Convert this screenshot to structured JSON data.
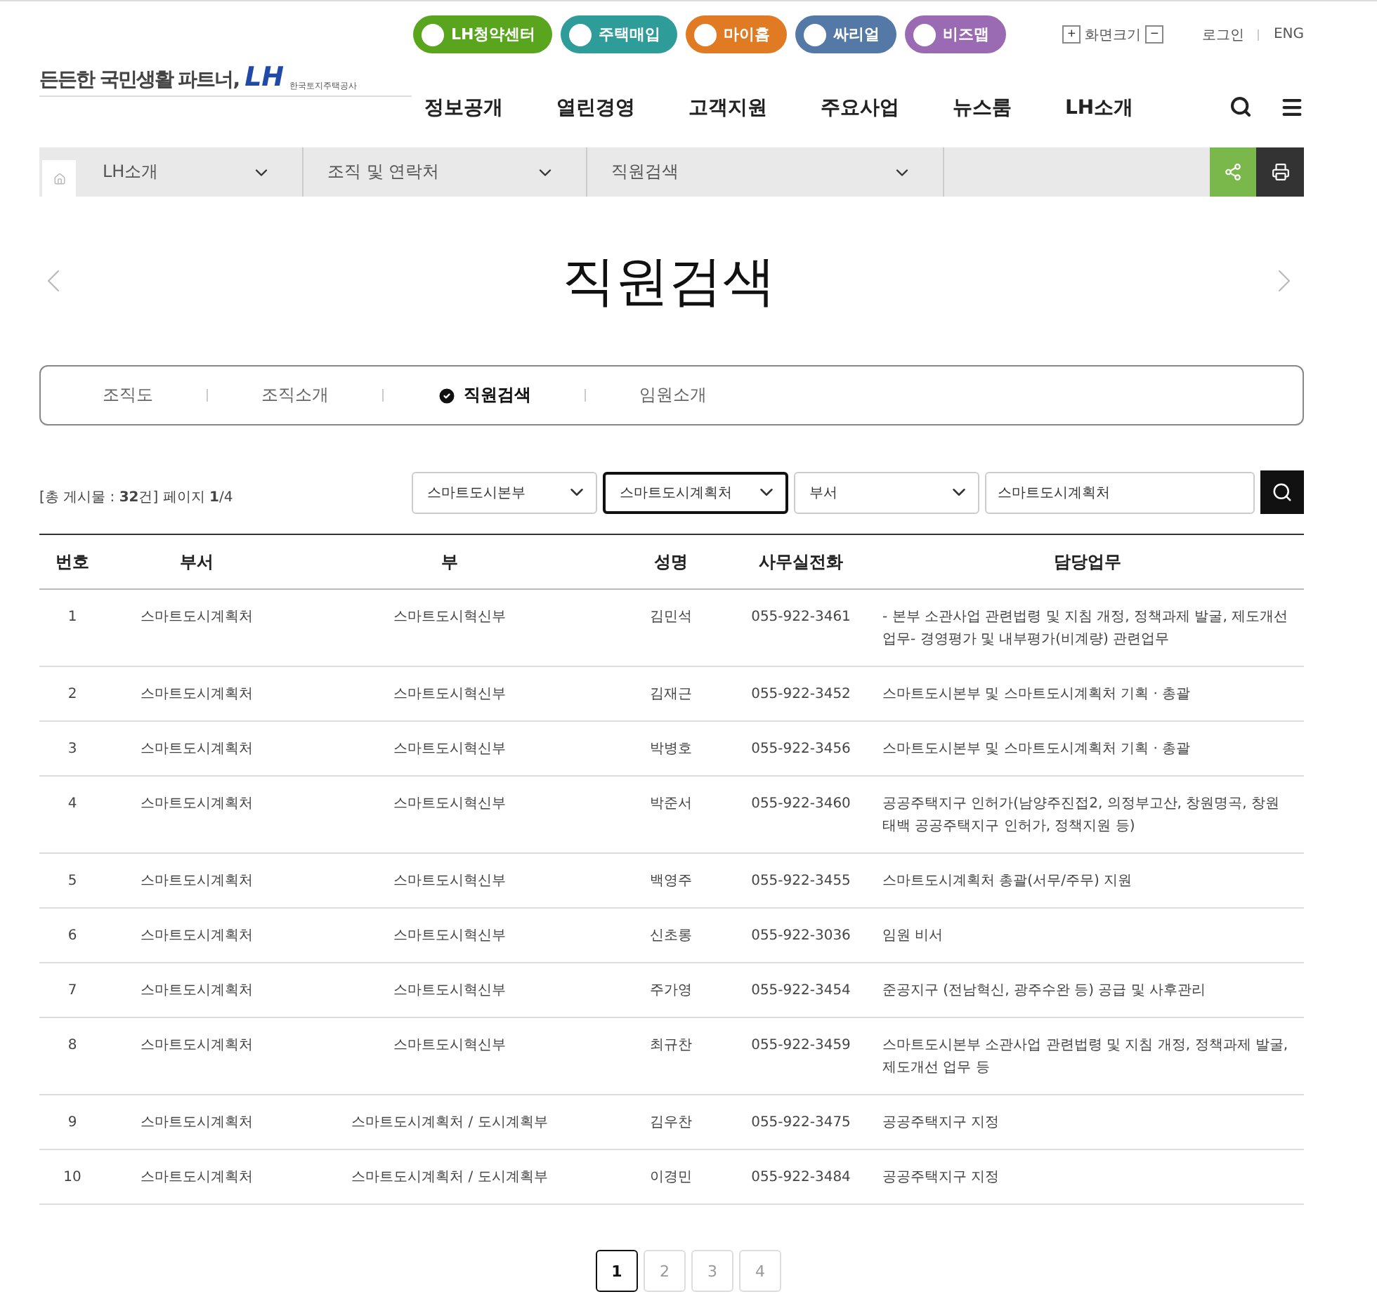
{
  "logo": {
    "slogan": "든든한 국민생활 파트너,",
    "mark": "LH",
    "org": "한국토지주택공사"
  },
  "quick_links": [
    {
      "label": "LH청약센터",
      "color": "#5aa51e"
    },
    {
      "label": "주택매입",
      "color": "#2e9c98"
    },
    {
      "label": "마이홈",
      "color": "#e07a23"
    },
    {
      "label": "싸리얼",
      "color": "#5479a6"
    },
    {
      "label": "비즈맵",
      "color": "#9a6bb3"
    }
  ],
  "font_size": {
    "label": "화면크기",
    "plus": "+",
    "minus": "−"
  },
  "util_links": [
    "로그인",
    "ENG"
  ],
  "nav": [
    "정보공개",
    "열린경영",
    "고객지원",
    "주요사업",
    "뉴스룸",
    "LH소개"
  ],
  "breadcrumb": [
    "LH소개",
    "조직 및 연락처",
    "직원검색"
  ],
  "page_title": "직원검색",
  "tabs": [
    {
      "label": "조직도",
      "selected": false
    },
    {
      "label": "조직소개",
      "selected": false
    },
    {
      "label": "직원검색",
      "selected": true
    },
    {
      "label": "임원소개",
      "selected": false
    }
  ],
  "summary": "[총 게시물 : **32**건] 페이지 **1**/4",
  "filters": {
    "selects": [
      {
        "value": "스마트도시본부",
        "focused": false
      },
      {
        "value": "스마트도시계획처",
        "focused": true
      },
      {
        "value": "부서",
        "focused": false
      }
    ],
    "search_value": "스마트도시계획처"
  },
  "table": {
    "columns": [
      "번호",
      "부서",
      "부",
      "성명",
      "사무실전화",
      "담당업무"
    ],
    "rows": [
      [
        "1",
        "스마트도시계획처",
        "스마트도시혁신부",
        "김민석",
        "055-922-3461",
        "- 본부 소관사업 관련법령 및 지침 개정, 정책과제 발굴, 제도개선 업무- 경영평가 및 내부평가(비계량) 관련업무"
      ],
      [
        "2",
        "스마트도시계획처",
        "스마트도시혁신부",
        "김재근",
        "055-922-3452",
        "스마트도시본부 및 스마트도시계획처 기획 · 총괄"
      ],
      [
        "3",
        "스마트도시계획처",
        "스마트도시혁신부",
        "박병호",
        "055-922-3456",
        "스마트도시본부 및 스마트도시계획처 기획 · 총괄"
      ],
      [
        "4",
        "스마트도시계획처",
        "스마트도시혁신부",
        "박준서",
        "055-922-3460",
        "공공주택지구 인허가(남양주진접2, 의정부고산, 창원명곡, 창원태백 공공주택지구 인허가, 정책지원 등)"
      ],
      [
        "5",
        "스마트도시계획처",
        "스마트도시혁신부",
        "백영주",
        "055-922-3455",
        "스마트도시계획처 총괄(서무/주무) 지원"
      ],
      [
        "6",
        "스마트도시계획처",
        "스마트도시혁신부",
        "신초롱",
        "055-922-3036",
        "임원 비서"
      ],
      [
        "7",
        "스마트도시계획처",
        "스마트도시혁신부",
        "주가영",
        "055-922-3454",
        "준공지구 (전남혁신, 광주수완 등) 공급 및 사후관리"
      ],
      [
        "8",
        "스마트도시계획처",
        "스마트도시혁신부",
        "최규찬",
        "055-922-3459",
        "스마트도시본부 소관사업 관련법령 및 지침 개정, 정책과제 발굴, 제도개선 업무 등"
      ],
      [
        "9",
        "스마트도시계획처",
        "스마트도시계획처 / 도시계획부",
        "김우찬",
        "055-922-3475",
        "공공주택지구 지정"
      ],
      [
        "10",
        "스마트도시계획처",
        "스마트도시계획처 / 도시계획부",
        "이경민",
        "055-922-3484",
        "공공주택지구 지정"
      ]
    ]
  },
  "pagination": [
    {
      "label": "1",
      "selected": true
    },
    {
      "label": "2",
      "selected": false
    },
    {
      "label": "3",
      "selected": false
    },
    {
      "label": "4",
      "selected": false
    }
  ]
}
